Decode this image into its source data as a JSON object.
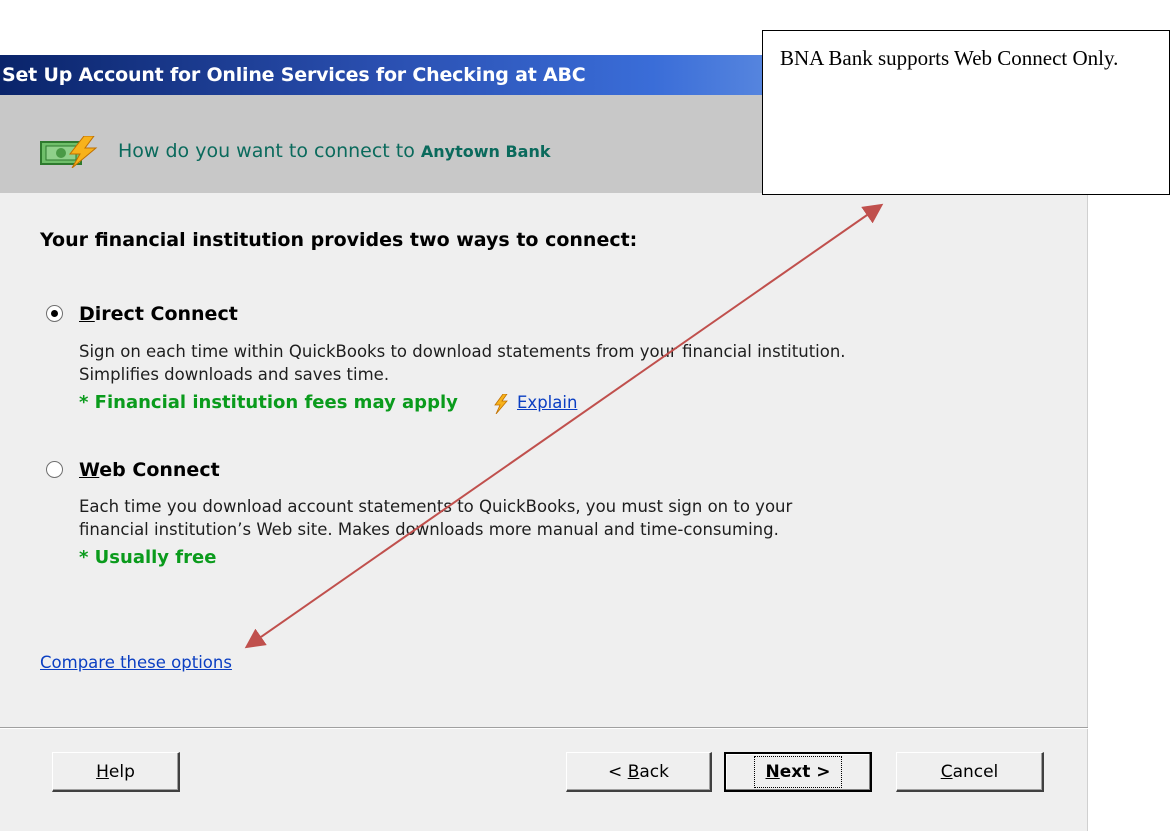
{
  "window": {
    "title": "Set Up Account for Online Services for Checking at ABC"
  },
  "header": {
    "prompt": "How do you want to connect to ",
    "bank_name": "Anytown Bank",
    "icon": "money-lightning-icon"
  },
  "main": {
    "section_title": "Your financial institution provides two ways to connect:",
    "options": [
      {
        "accel": "D",
        "label_rest": "irect Connect",
        "selected": true,
        "desc_lines": [
          "Sign on each time within QuickBooks to download statements from your financial institution.",
          "Simplifies downloads and saves time."
        ],
        "note": "* Financial institution fees may apply",
        "explain_link": "Explain"
      },
      {
        "accel": "W",
        "label_rest": "eb Connect",
        "selected": false,
        "desc_lines": [
          "Each time you download account statements to QuickBooks, you must sign on to your",
          "financial institution’s Web site. Makes downloads more manual and time-consuming."
        ],
        "note": "* Usually free"
      }
    ],
    "compare_link": "Compare these options"
  },
  "buttons": {
    "help": {
      "accel": "H",
      "rest": "elp"
    },
    "back": {
      "pre": "< ",
      "accel": "B",
      "rest": "ack"
    },
    "next": {
      "accel": "N",
      "rest": "ext >"
    },
    "cancel": {
      "accel": "C",
      "rest": "ancel"
    }
  },
  "annotation": {
    "text": "BNA Bank supports Web Connect Only.",
    "arrow_color": "#c0504d"
  },
  "colors": {
    "note_green": "#0a9b1c",
    "header_teal": "#0a6a5c",
    "link_blue": "#0a3ec2"
  }
}
